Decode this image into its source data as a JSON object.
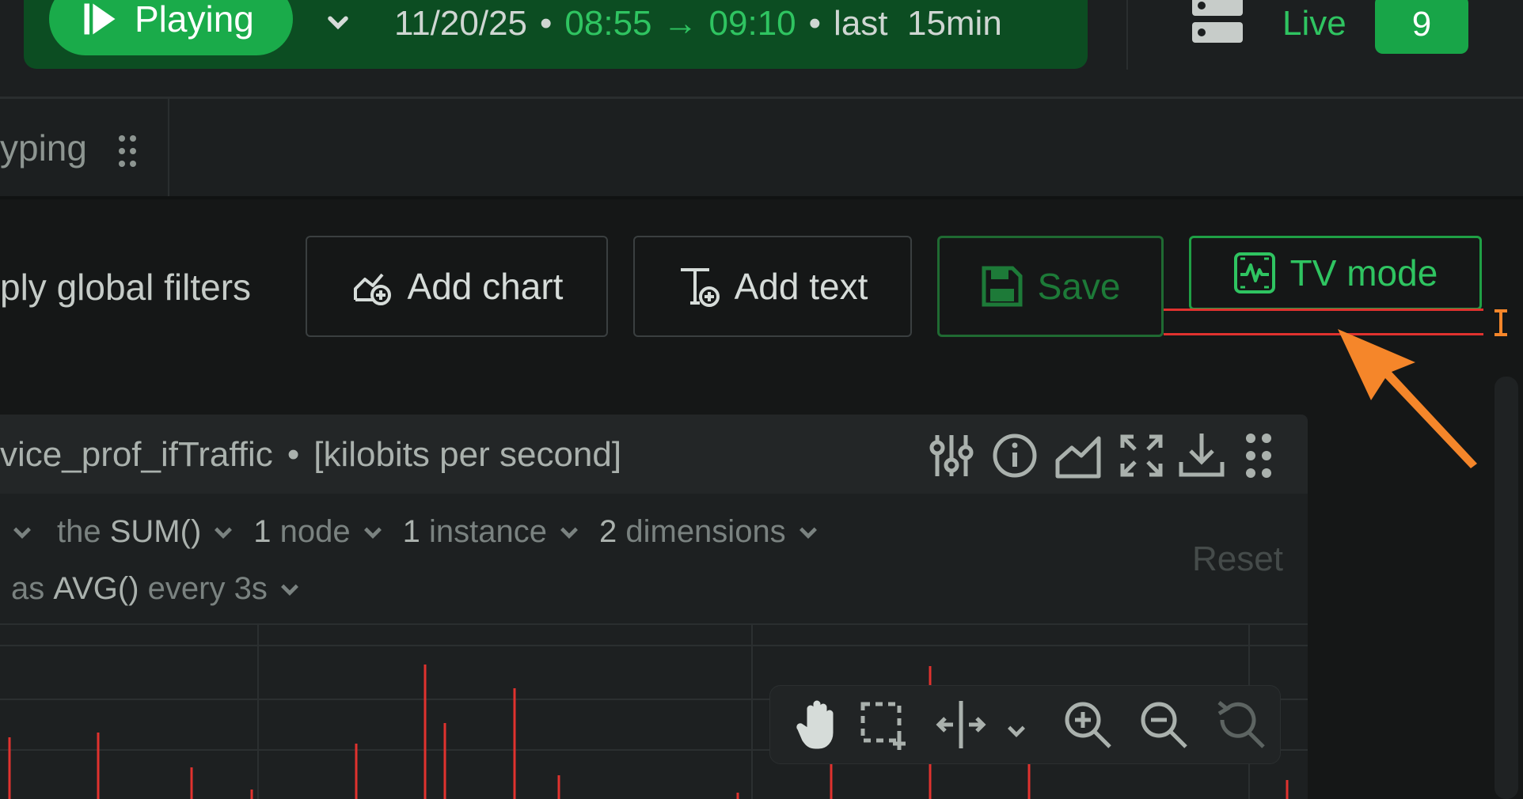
{
  "topbar": {
    "play_label": "Playing",
    "date": "11/20/25",
    "bullet": "•",
    "start_time": "08:55",
    "arrow": "→",
    "end_time": "09:10",
    "range_label": "last  15min",
    "live_label": "Live",
    "live_count": "9",
    "icons": [
      "play-icon",
      "chevron-down-icon",
      "server-icon"
    ]
  },
  "tab": {
    "title": "yping",
    "icon": "drag-handle-icon"
  },
  "toolbar": {
    "global_filters_label": "ply global filters",
    "add_chart_label": "Add chart",
    "add_text_label": "Add text",
    "save_label": "Save",
    "tv_mode_label": "TV mode",
    "icons": [
      "add-chart-icon",
      "add-text-icon",
      "save-icon",
      "tv-mode-icon"
    ]
  },
  "chart": {
    "title": "vice_prof_ifTraffic",
    "title_sep": "•",
    "units": "[kilobits per second]",
    "header_icons": [
      "settings-sliders-icon",
      "info-icon",
      "chart-type-icon",
      "fullscreen-icon",
      "download-icon",
      "drag-handle-icon"
    ],
    "filters": {
      "the_label": "the",
      "aggregation": "SUM()",
      "nodes_count": "1",
      "nodes_label": "node",
      "instances_count": "1",
      "instances_label": "instance",
      "dimensions_count": "2",
      "dimensions_label": "dimensions",
      "as_label": "as",
      "time_aggregation": "AVG()",
      "every_label": "every 3s",
      "reset_label": "Reset"
    },
    "tools": [
      "pan-hand-icon",
      "select-area-icon",
      "column-resize-icon",
      "chevron-down-icon",
      "zoom-in-icon",
      "zoom-out-icon",
      "zoom-reset-icon"
    ],
    "series_color": "#e0322e"
  },
  "colors": {
    "accent_green": "#2fc461",
    "play_green": "#1aab4a",
    "annotation_orange": "#f5862a",
    "annotation_red": "#e0322e"
  }
}
